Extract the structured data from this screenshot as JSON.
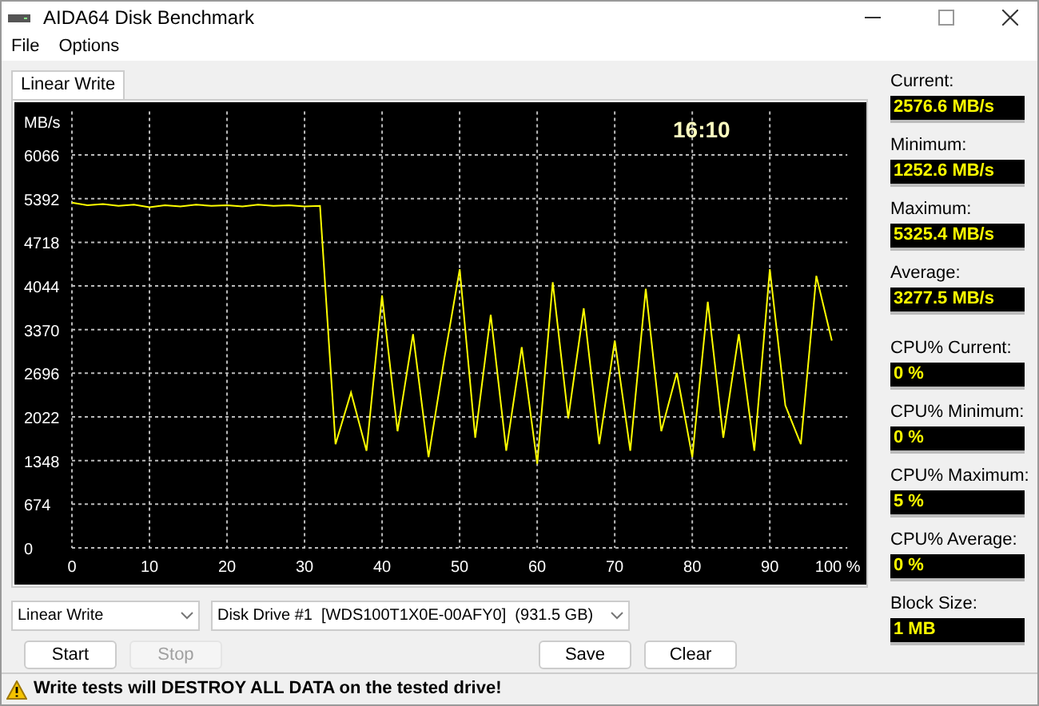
{
  "window": {
    "title": "AIDA64 Disk Benchmark"
  },
  "menu": [
    {
      "label": "File"
    },
    {
      "label": "Options"
    }
  ],
  "tabs": [
    {
      "label": "Linear Write",
      "selected": true
    }
  ],
  "chart": {
    "elapsed_time": "16:10",
    "chart_data": {
      "type": "line",
      "ylabel": "MB/s",
      "x": [
        0,
        2,
        4,
        6,
        8,
        10,
        12,
        14,
        16,
        18,
        20,
        22,
        24,
        26,
        28,
        30,
        32,
        34,
        36,
        38,
        40,
        42,
        44,
        46,
        48,
        50,
        52,
        54,
        56,
        58,
        60,
        62,
        64,
        66,
        68,
        70,
        72,
        74,
        76,
        78,
        80,
        82,
        84,
        86,
        88,
        90,
        92,
        94,
        96,
        98
      ],
      "grid": true,
      "series": [
        {
          "color": "#ffff00",
          "values": [
            5330,
            5290,
            5310,
            5280,
            5300,
            5260,
            5290,
            5270,
            5300,
            5280,
            5290,
            5270,
            5300,
            5280,
            5290,
            5270,
            5280,
            1600,
            2400,
            1500,
            3900,
            1800,
            3300,
            1400,
            2900,
            4300,
            1700,
            3600,
            1500,
            3100,
            1300,
            4100,
            2000,
            3700,
            1600,
            3200,
            1500,
            4000,
            1800,
            2700,
            1400,
            3800,
            1700,
            3300,
            1500,
            4300,
            2200,
            1600,
            4200,
            3200
          ]
        }
      ],
      "xlim": [
        0,
        100
      ],
      "ylim": [
        0,
        6740
      ],
      "xticks": [
        0,
        10,
        20,
        30,
        40,
        50,
        60,
        70,
        80,
        90,
        {
          "value": 100,
          "label": "100 %"
        }
      ],
      "yticks": [
        0,
        674,
        1348,
        2022,
        2696,
        3370,
        4044,
        4718,
        5392,
        6066
      ]
    }
  },
  "stats": [
    {
      "label": "Current:",
      "value": "2576.6 MB/s"
    },
    {
      "label": "Minimum:",
      "value": "1252.6 MB/s"
    },
    {
      "label": "Maximum:",
      "value": "5325.4 MB/s"
    },
    {
      "label": "Average:",
      "value": "3277.5 MB/s"
    },
    {
      "label": "CPU% Current:",
      "value": "0 %"
    },
    {
      "label": "CPU% Minimum:",
      "value": "0 %"
    },
    {
      "label": "CPU% Maximum:",
      "value": "5 %"
    },
    {
      "label": "CPU% Average:",
      "value": "0 %"
    },
    {
      "label": "Block Size:",
      "value": "1 MB"
    }
  ],
  "test_select": {
    "value": "Linear Write"
  },
  "drive_select": {
    "value": "Disk Drive #1  [WDS100T1X0E-00AFY0]  (931.5 GB)"
  },
  "buttons": [
    {
      "label": "Start",
      "disabled": false
    },
    {
      "label": "Stop",
      "disabled": true
    },
    {
      "label": "Save",
      "disabled": false
    },
    {
      "label": "Clear",
      "disabled": false
    }
  ],
  "status_bar": {
    "message": "Write tests will DESTROY ALL DATA on the tested drive!"
  }
}
